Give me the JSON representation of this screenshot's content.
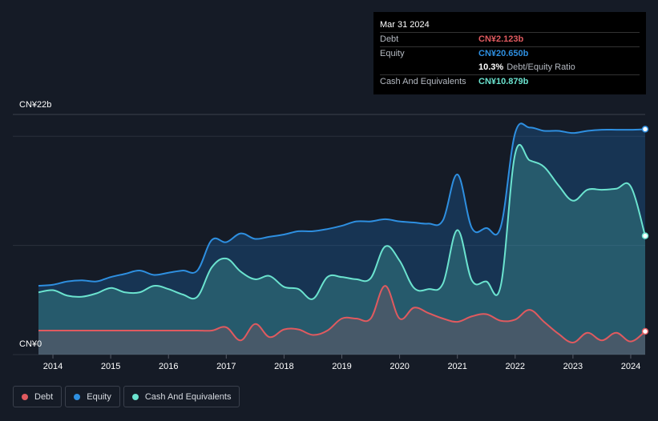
{
  "tooltip": {
    "date": "Mar 31 2024",
    "rows": [
      {
        "label": "Debt",
        "value": "CN¥2.123b"
      },
      {
        "label": "Equity",
        "value": "CN¥20.650b"
      },
      {
        "label": "Cash And Equivalents",
        "value": "CN¥10.879b"
      }
    ],
    "ratio_value": "10.3%",
    "ratio_label": "Debt/Equity Ratio"
  },
  "y_axis": {
    "top_label": "CN¥22b",
    "bottom_label": "CN¥0"
  },
  "legend": [
    {
      "label": "Debt",
      "color": "#e05a5f"
    },
    {
      "label": "Equity",
      "color": "#2e8fe0"
    },
    {
      "label": "Cash And Equivalents",
      "color": "#6be3cf"
    }
  ],
  "colors": {
    "debt": "#e05a5f",
    "equity": "#2e8fe0",
    "cash": "#6be3cf",
    "background": "#151b26"
  },
  "chart_data": {
    "type": "area",
    "xlabel": "",
    "ylabel": "",
    "ylim": [
      0,
      22
    ],
    "x_ticks": [
      "2014",
      "2015",
      "2016",
      "2017",
      "2018",
      "2019",
      "2020",
      "2021",
      "2022",
      "2023",
      "2024"
    ],
    "x": [
      2013.75,
      2014.0,
      2014.25,
      2014.5,
      2014.75,
      2015.0,
      2015.25,
      2015.5,
      2015.75,
      2016.0,
      2016.25,
      2016.5,
      2016.75,
      2017.0,
      2017.25,
      2017.5,
      2017.75,
      2018.0,
      2018.25,
      2018.5,
      2018.75,
      2019.0,
      2019.25,
      2019.5,
      2019.75,
      2020.0,
      2020.25,
      2020.5,
      2020.75,
      2021.0,
      2021.25,
      2021.5,
      2021.75,
      2022.0,
      2022.25,
      2022.5,
      2022.75,
      2023.0,
      2023.25,
      2023.5,
      2023.75,
      2024.0,
      2024.25
    ],
    "series": [
      {
        "name": "Debt",
        "values": [
          2.2,
          2.2,
          2.2,
          2.2,
          2.2,
          2.2,
          2.2,
          2.2,
          2.2,
          2.2,
          2.2,
          2.2,
          2.2,
          2.5,
          1.3,
          2.8,
          1.6,
          2.3,
          2.3,
          1.8,
          2.2,
          3.3,
          3.3,
          3.3,
          6.3,
          3.3,
          4.3,
          3.8,
          3.3,
          3.0,
          3.5,
          3.7,
          3.1,
          3.2,
          4.1,
          3.0,
          1.9,
          1.1,
          2.0,
          1.3,
          2.0,
          1.2,
          2.123
        ]
      },
      {
        "name": "Equity",
        "values": [
          6.3,
          6.4,
          6.7,
          6.8,
          6.7,
          7.1,
          7.4,
          7.7,
          7.3,
          7.5,
          7.7,
          7.7,
          10.5,
          10.3,
          11.1,
          10.6,
          10.8,
          11.0,
          11.3,
          11.3,
          11.5,
          11.8,
          12.2,
          12.2,
          12.4,
          12.2,
          12.1,
          12.0,
          12.3,
          16.5,
          11.6,
          11.6,
          11.7,
          20.3,
          20.8,
          20.5,
          20.5,
          20.3,
          20.5,
          20.6,
          20.6,
          20.6,
          20.65
        ]
      },
      {
        "name": "Cash And Equivalents",
        "values": [
          5.7,
          5.9,
          5.4,
          5.3,
          5.6,
          6.1,
          5.7,
          5.7,
          6.3,
          6.0,
          5.5,
          5.3,
          8.0,
          8.8,
          7.6,
          6.9,
          7.2,
          6.2,
          6.0,
          5.1,
          7.1,
          7.1,
          6.9,
          7.0,
          9.9,
          8.6,
          6.1,
          6.0,
          6.5,
          11.4,
          6.8,
          6.7,
          6.3,
          18.4,
          17.8,
          17.2,
          15.5,
          14.1,
          15.1,
          15.1,
          15.2,
          15.4,
          10.879
        ]
      }
    ]
  }
}
